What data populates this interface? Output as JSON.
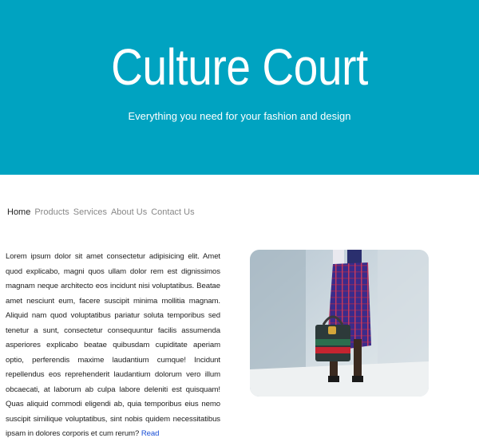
{
  "hero": {
    "title": "Culture Court",
    "tagline": "Everything you need for your fashion and design"
  },
  "nav": {
    "items": [
      {
        "label": "Home",
        "active": true
      },
      {
        "label": "Products",
        "active": false
      },
      {
        "label": "Services",
        "active": false
      },
      {
        "label": "About Us",
        "active": false
      },
      {
        "label": "Contact Us",
        "active": false
      }
    ]
  },
  "article": {
    "body": "Lorem ipsum dolor sit amet consectetur adipisicing elit. Amet quod explicabo, magni quos ullam dolor rem est dignissimos magnam neque architecto eos incidunt nisi voluptatibus. Beatae amet nesciunt eum, facere suscipit minima mollitia magnam. Aliquid nam quod voluptatibus pariatur soluta temporibus sed tenetur a sunt, consectetur consequuntur facilis assumenda asperiores explicabo beataе quibusdam cupiditate aperiam optio, perferendis maxime laudantium cumque! Incidunt repellendus eos reprehenderit laudantium dolorum vero illum obcaecati, at laborum ab culpa labore deleniti est quisquam! Quas aliquid commodi eligendi ab, quia temporibus eius nemo suscipit similique voluptatibus, sint nobis quidem necessitatibus ipsam in dolores corporis et cum rerum?",
    "read_more": "Read"
  },
  "colors": {
    "hero_background": "#00a3c1",
    "link": "#1a4fd6"
  }
}
